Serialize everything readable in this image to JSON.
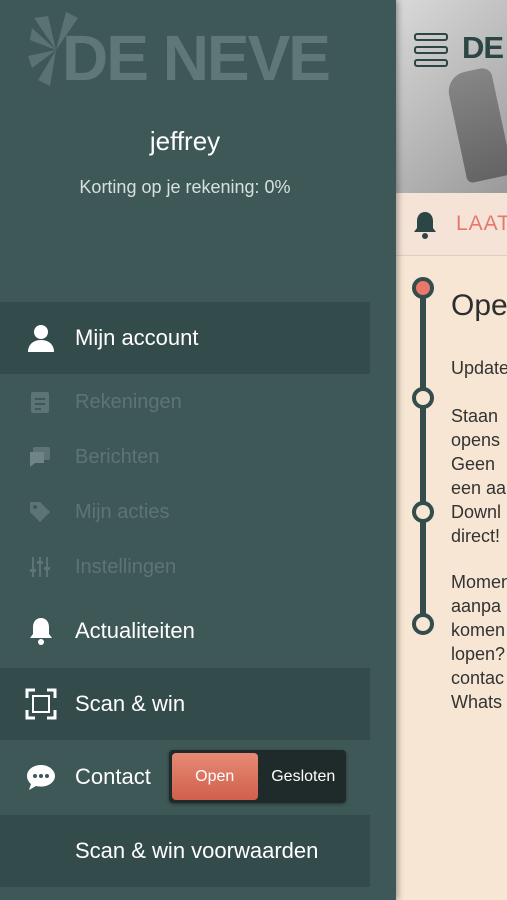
{
  "brand": {
    "logo_text": "DE NEVE"
  },
  "user": {
    "name": "jeffrey",
    "discount_text": "Korting op je rekening: 0%"
  },
  "menu": {
    "account": "Mijn account",
    "sub_items": [
      {
        "label": "Rekeningen",
        "icon": "invoice-icon"
      },
      {
        "label": "Berichten",
        "icon": "messages-icon"
      },
      {
        "label": "Mijn acties",
        "icon": "tag-icon"
      },
      {
        "label": "Instellingen",
        "icon": "sliders-icon"
      }
    ],
    "news": "Actualiteiten",
    "scan": "Scan & win",
    "contact": "Contact",
    "terms": "Scan & win voorwaarden"
  },
  "contact_toggle": {
    "open": "Open",
    "closed": "Gesloten",
    "selected": "Open"
  },
  "background": {
    "header_logo": "DE",
    "notice_text": "LAAT",
    "post_title": "Ope",
    "paragraph1": "Update",
    "paragraph2": "Staan\nopens\nGeen\neen aa\nDownl\ndirect!",
    "paragraph3": "Momen\naanpa\nkomen\nlopen?\ncontac\nWhats"
  },
  "colors": {
    "drawer_bg": "#3e5757",
    "band_bg": "#344b4b",
    "accent": "#e8776c",
    "content_bg": "#f6e6d3"
  }
}
